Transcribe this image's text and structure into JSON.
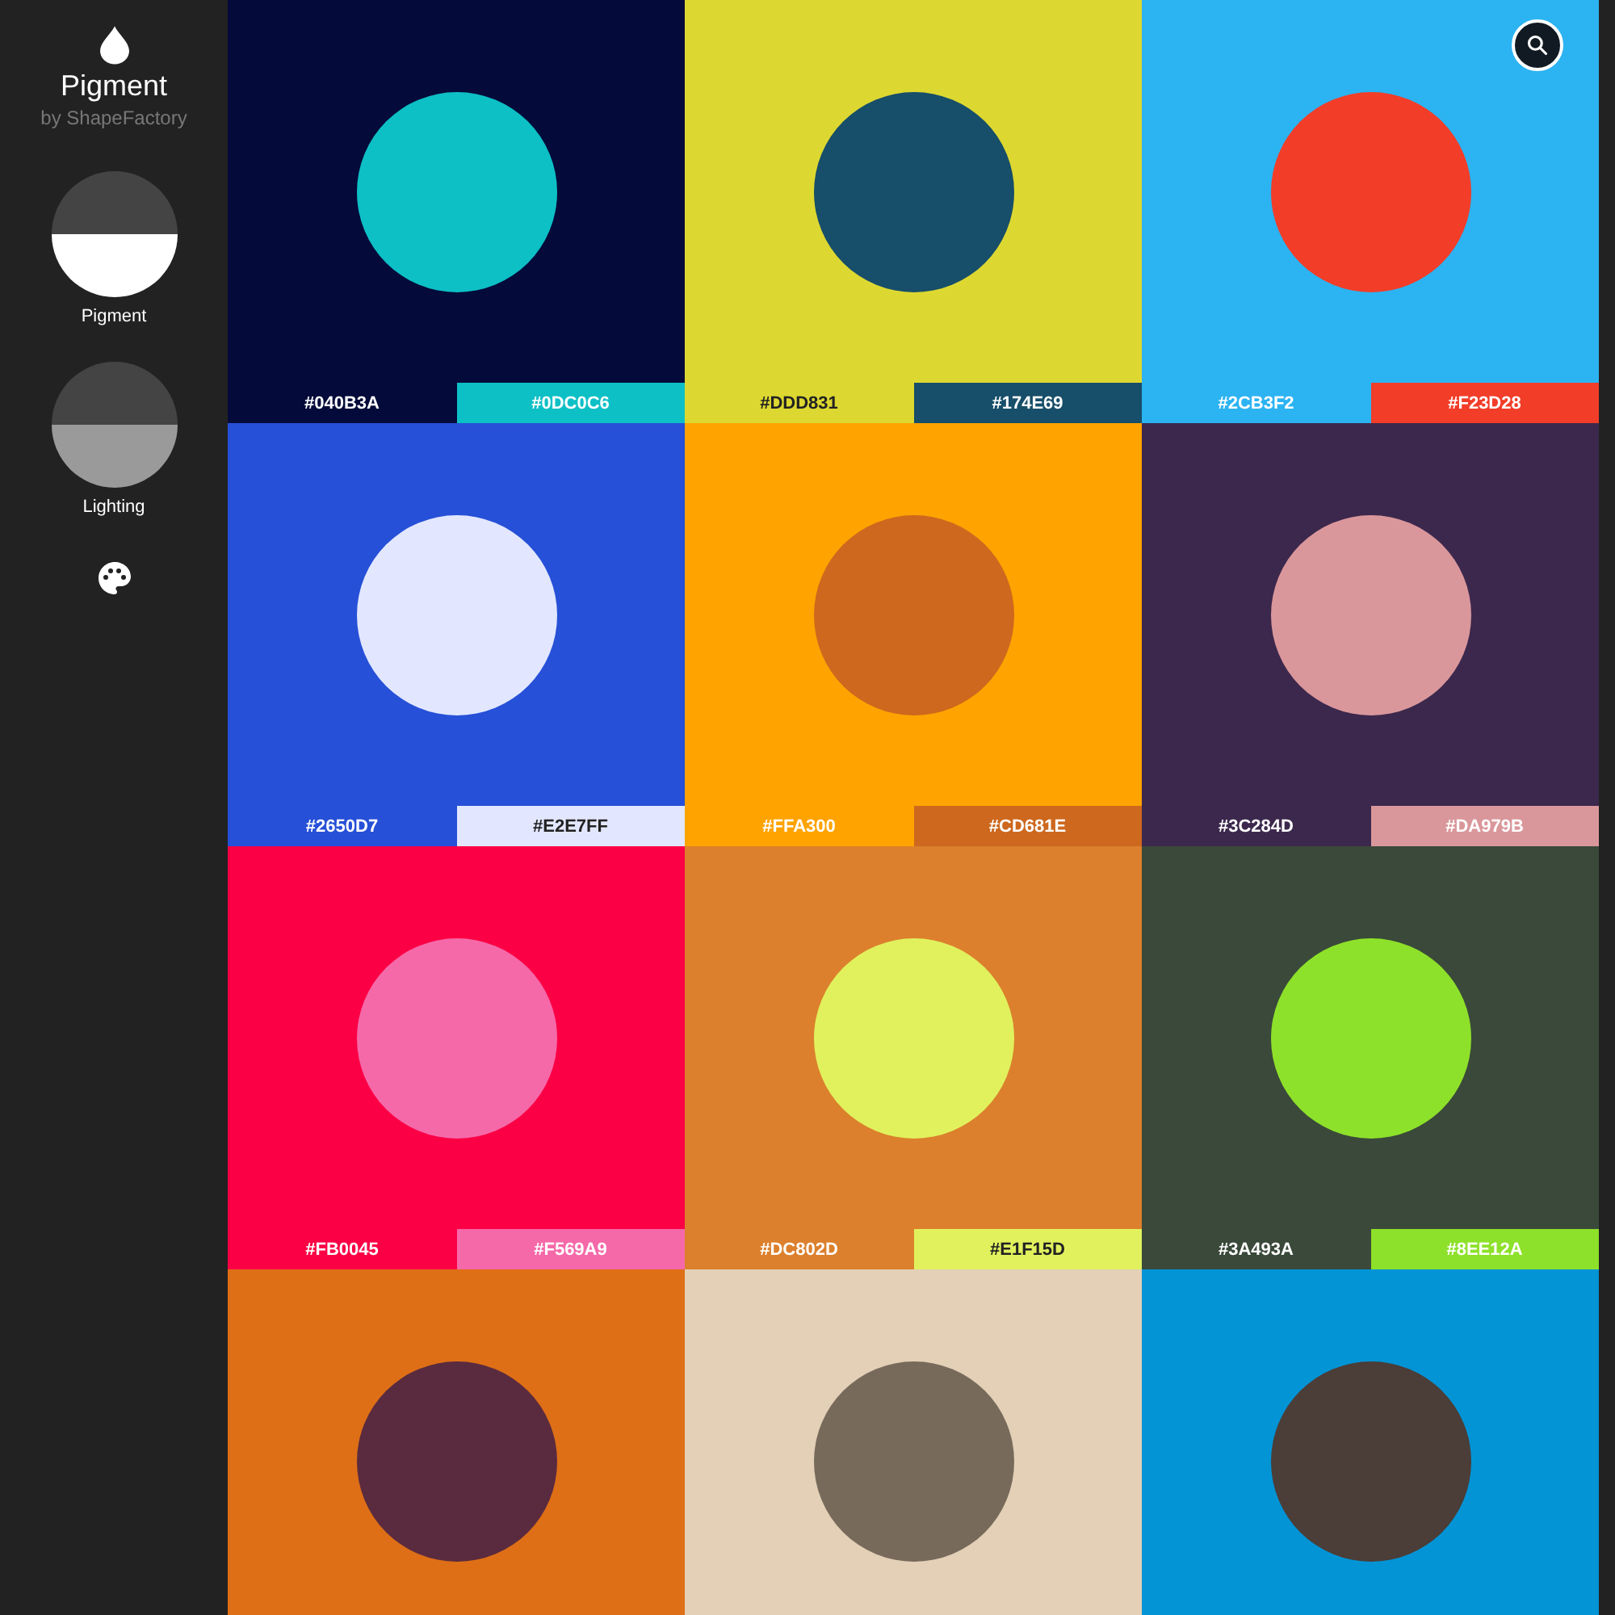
{
  "app": {
    "title": "Pigment",
    "subtitle": "by ShapeFactory"
  },
  "modes": [
    {
      "label": "Pigment",
      "selected": true
    },
    {
      "label": "Lighting",
      "selected": false
    }
  ],
  "swatches": [
    {
      "background": {
        "color": "#040b3a",
        "label": "#040B3A"
      },
      "circle": {
        "color": "#0dc0c6",
        "label": "#0DC0C6"
      }
    },
    {
      "background": {
        "color": "#ddd831",
        "label": "#DDD831"
      },
      "circle": {
        "color": "#174e69",
        "label": "#174E69"
      }
    },
    {
      "background": {
        "color": "#2cb3f2",
        "label": "#2CB3F2"
      },
      "circle": {
        "color": "#f23d28",
        "label": "#F23D28"
      }
    },
    {
      "background": {
        "color": "#2650d7",
        "label": "#2650D7"
      },
      "circle": {
        "color": "#e2e7ff",
        "label": "#E2E7FF"
      }
    },
    {
      "background": {
        "color": "#ffa300",
        "label": "#FFA300"
      },
      "circle": {
        "color": "#cd681e",
        "label": "#CD681E"
      }
    },
    {
      "background": {
        "color": "#3c284d",
        "label": "#3C284D"
      },
      "circle": {
        "color": "#da979b",
        "label": "#DA979B"
      }
    },
    {
      "background": {
        "color": "#fb0045",
        "label": "#FB0045"
      },
      "circle": {
        "color": "#f569a9",
        "label": "#F569A9"
      }
    },
    {
      "background": {
        "color": "#dc802d",
        "label": "#DC802D"
      },
      "circle": {
        "color": "#e1f15d",
        "label": "#E1F15D"
      }
    },
    {
      "background": {
        "color": "#3a493a",
        "label": "#3A493A"
      },
      "circle": {
        "color": "#8ee12a",
        "label": "#8EE12A"
      }
    },
    {
      "background": {
        "color": "#de6f16"
      },
      "circle": {
        "color": "#5a2b3f"
      }
    },
    {
      "background": {
        "color": "#e3d0b7"
      },
      "circle": {
        "color": "#776a5b"
      }
    },
    {
      "background": {
        "color": "#0394d6"
      },
      "circle": {
        "color": "#4b3d37"
      }
    }
  ]
}
